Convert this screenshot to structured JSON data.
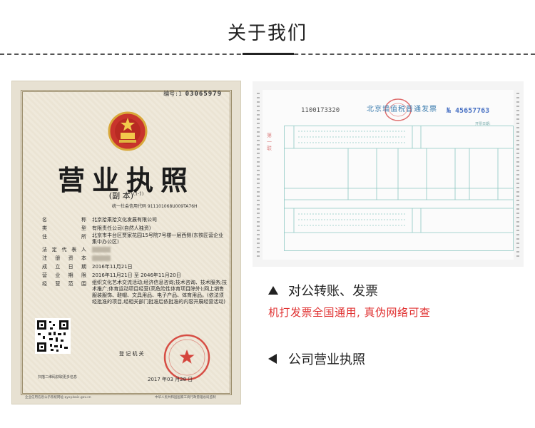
{
  "header": {
    "title": "关于我们"
  },
  "license": {
    "serial_label": "编号:1",
    "serial_number": "03065979",
    "title": "营业执照",
    "copy_label": "(副 本)",
    "copy_index": "(1-1)",
    "credit_code": "统一社会信用代码 911101068U009TA76H",
    "fields": [
      {
        "key": "名 称",
        "value": "北京拾乘拾文化发展有限公司"
      },
      {
        "key": "类 型",
        "value": "有限责任公司(自然人独资)"
      },
      {
        "key": "住 所",
        "value": "北京市丰台区贾家花园15号院7号楼一层西侧(东铁匠营企业集中办公区)"
      },
      {
        "key": "法定代表人",
        "value": ""
      },
      {
        "key": "注册资本",
        "value": ""
      },
      {
        "key": "成立日期",
        "value": "2016年11月21日"
      },
      {
        "key": "营业期限",
        "value": "2016年11月21日 至 2046年11月20日"
      },
      {
        "key": "经营范围",
        "value": "组织文化艺术交流活动;经济信息咨询;技术咨询、技术服务;技术推广;体育运动项目经营(高危险性体育项目除外);网上销售服装服饰、鞋帽、文具用品、电子产品、体育用品。(依法须经批准的项目,经相关部门批准后依批准的内容开展经营活动)"
      }
    ],
    "qr_caption": "扫描二维码获取更多信息",
    "registration_label": "登 记 机 关",
    "date": "2017 年03 月28 日",
    "footer_left": "企业信用信息公示系统网址:qyxy.baic.gov.cn",
    "footer_right": "中华人民共和国国家工商行政管理总局监制"
  },
  "invoice": {
    "code": "1100173320",
    "title": "北京增值税普通发票",
    "number": "№ 45657763",
    "date_label": "开票日期:",
    "side_note": "第一联"
  },
  "features": [
    {
      "label": "对公转账、发票",
      "sub": "机打发票全国通用, 真伪网络可查"
    },
    {
      "label": "公司营业执照"
    }
  ],
  "colors": {
    "accent_red": "#e03030",
    "text": "#222222"
  }
}
